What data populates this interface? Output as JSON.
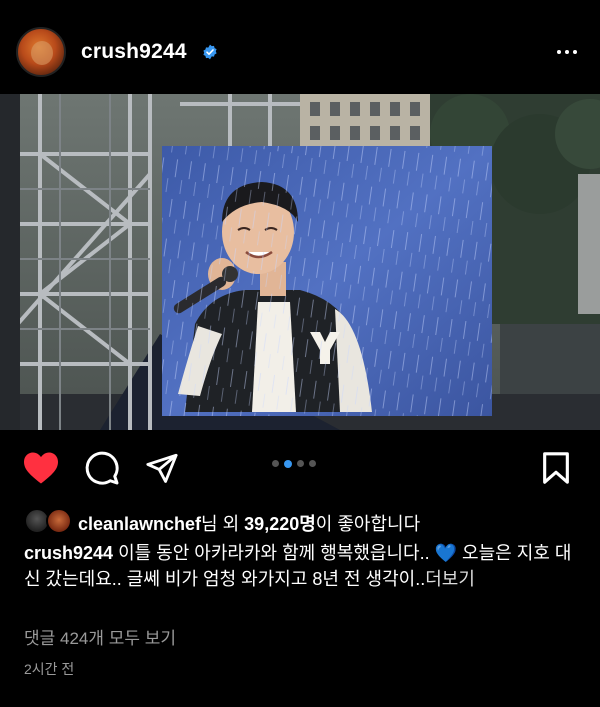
{
  "post": {
    "username": "crush9244",
    "verified_icon": "verified-badge-icon",
    "more_icon": "ellipsis-icon"
  },
  "actions": {
    "like_icon": "heart-filled-icon",
    "comment_icon": "comment-icon",
    "share_icon": "send-icon",
    "save_icon": "bookmark-icon",
    "carousel_count": 4,
    "carousel_active_index": 1
  },
  "likes": {
    "liker_name": "cleanlawnchef",
    "suffix_1": "님 외 ",
    "count": "39,220명",
    "suffix_2": "이 좋아합니다"
  },
  "caption": {
    "author": "crush9244",
    "text_1": " 이틀 동안 아카라카와 함께 행복했읍니다.. ",
    "emoji": "💙",
    "text_2": " 오늘은 지호 대신 갔는데요.. 글쎄 비가 엄청 와가지고 8년 전 생각이..",
    "more_label": "더보기"
  },
  "comments_label": "댓글 424개 모두 보기",
  "timestamp": "2시간 전",
  "colors": {
    "background": "#000000",
    "like_red": "#ff3040",
    "verified_blue": "#3897f0",
    "muted_text": "#9a9a9a"
  }
}
